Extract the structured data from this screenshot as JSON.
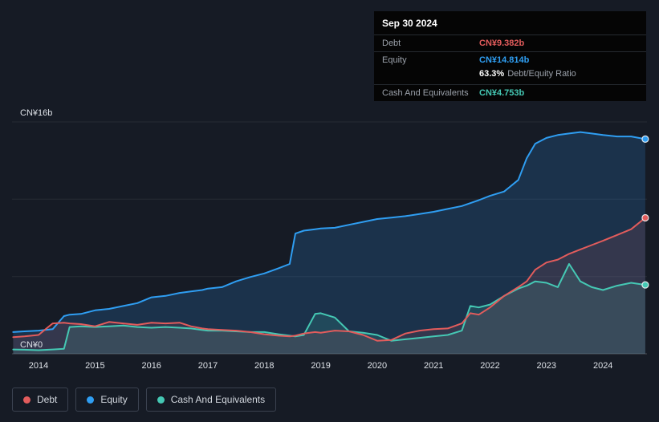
{
  "tooltip": {
    "date": "Sep 30 2024",
    "debt_label": "Debt",
    "debt_value": "CN¥9.382b",
    "equity_label": "Equity",
    "equity_value": "CN¥14.814b",
    "ratio_value": "63.3%",
    "ratio_label": "Debt/Equity Ratio",
    "cash_label": "Cash And Equivalents",
    "cash_value": "CN¥4.753b"
  },
  "legend": {
    "debt_label": "Debt",
    "equity_label": "Equity",
    "cash_label": "Cash And Equivalents"
  },
  "colors": {
    "debt": "#e25c5c",
    "equity": "#2f9ef2",
    "cash": "#45c8b4",
    "background": "#161b25",
    "tooltip_background": "#050505"
  },
  "chart_data": {
    "type": "area",
    "title": "",
    "xlabel": "",
    "ylabel": "",
    "grid": true,
    "legend_position": "bottom-left",
    "x_range": [
      2013.53,
      2024.78
    ],
    "y_range": [
      0,
      16
    ],
    "y_ticks": [
      {
        "value": 16,
        "label": "CN¥16b"
      },
      {
        "value": 0,
        "label": "CN¥0"
      }
    ],
    "x_ticks": [
      2014,
      2015,
      2016,
      2017,
      2018,
      2019,
      2020,
      2021,
      2022,
      2023,
      2024
    ],
    "x": [
      2013.55,
      2013.75,
      2014.0,
      2014.25,
      2014.45,
      2014.55,
      2014.75,
      2015.0,
      2015.25,
      2015.5,
      2015.75,
      2016.0,
      2016.25,
      2016.5,
      2016.7,
      2016.9,
      2017.0,
      2017.25,
      2017.5,
      2017.75,
      2018.0,
      2018.25,
      2018.45,
      2018.55,
      2018.7,
      2018.9,
      2019.0,
      2019.25,
      2019.5,
      2019.75,
      2020.0,
      2020.25,
      2020.5,
      2020.75,
      2021.0,
      2021.25,
      2021.5,
      2021.65,
      2021.8,
      2022.0,
      2022.25,
      2022.5,
      2022.65,
      2022.8,
      2023.0,
      2023.2,
      2023.4,
      2023.6,
      2023.8,
      2024.0,
      2024.25,
      2024.5,
      2024.75
    ],
    "series": [
      {
        "name": "Debt",
        "color": "#e25c5c",
        "fill": "rgba(226,92,92,0.13)",
        "values": [
          1.15,
          1.2,
          1.3,
          2.1,
          2.15,
          2.1,
          2.05,
          1.9,
          2.2,
          2.1,
          2.0,
          2.15,
          2.1,
          2.15,
          1.9,
          1.75,
          1.7,
          1.65,
          1.6,
          1.5,
          1.35,
          1.25,
          1.2,
          1.25,
          1.4,
          1.5,
          1.45,
          1.6,
          1.55,
          1.3,
          0.9,
          0.95,
          1.4,
          1.6,
          1.7,
          1.75,
          2.1,
          2.8,
          2.7,
          3.2,
          4.0,
          4.6,
          5.0,
          5.8,
          6.3,
          6.5,
          6.9,
          7.2,
          7.5,
          7.8,
          8.2,
          8.6,
          9.382
        ]
      },
      {
        "name": "Equity",
        "color": "#2f9ef2",
        "fill": "rgba(43,118,190,0.25)",
        "values": [
          1.5,
          1.55,
          1.6,
          1.7,
          2.6,
          2.7,
          2.75,
          3.0,
          3.1,
          3.3,
          3.5,
          3.9,
          4.0,
          4.2,
          4.3,
          4.4,
          4.5,
          4.6,
          5.0,
          5.3,
          5.55,
          5.9,
          6.2,
          8.3,
          8.5,
          8.6,
          8.65,
          8.7,
          8.9,
          9.1,
          9.3,
          9.4,
          9.5,
          9.65,
          9.8,
          10.0,
          10.2,
          10.4,
          10.6,
          10.9,
          11.2,
          12.0,
          13.5,
          14.5,
          14.9,
          15.1,
          15.2,
          15.3,
          15.2,
          15.1,
          15.0,
          15.0,
          14.814
        ]
      },
      {
        "name": "Cash And Equivalents",
        "color": "#45c8b4",
        "fill": "rgba(69,200,180,0.16)",
        "values": [
          0.3,
          0.28,
          0.25,
          0.3,
          0.35,
          1.85,
          1.9,
          1.85,
          1.9,
          1.95,
          1.85,
          1.8,
          1.85,
          1.8,
          1.75,
          1.65,
          1.6,
          1.6,
          1.55,
          1.5,
          1.5,
          1.35,
          1.25,
          1.2,
          1.3,
          2.75,
          2.8,
          2.5,
          1.55,
          1.45,
          1.3,
          0.9,
          1.0,
          1.1,
          1.2,
          1.3,
          1.6,
          3.3,
          3.2,
          3.4,
          4.0,
          4.5,
          4.7,
          5.0,
          4.9,
          4.6,
          6.2,
          5.0,
          4.6,
          4.4,
          4.7,
          4.9,
          4.753
        ]
      }
    ]
  }
}
